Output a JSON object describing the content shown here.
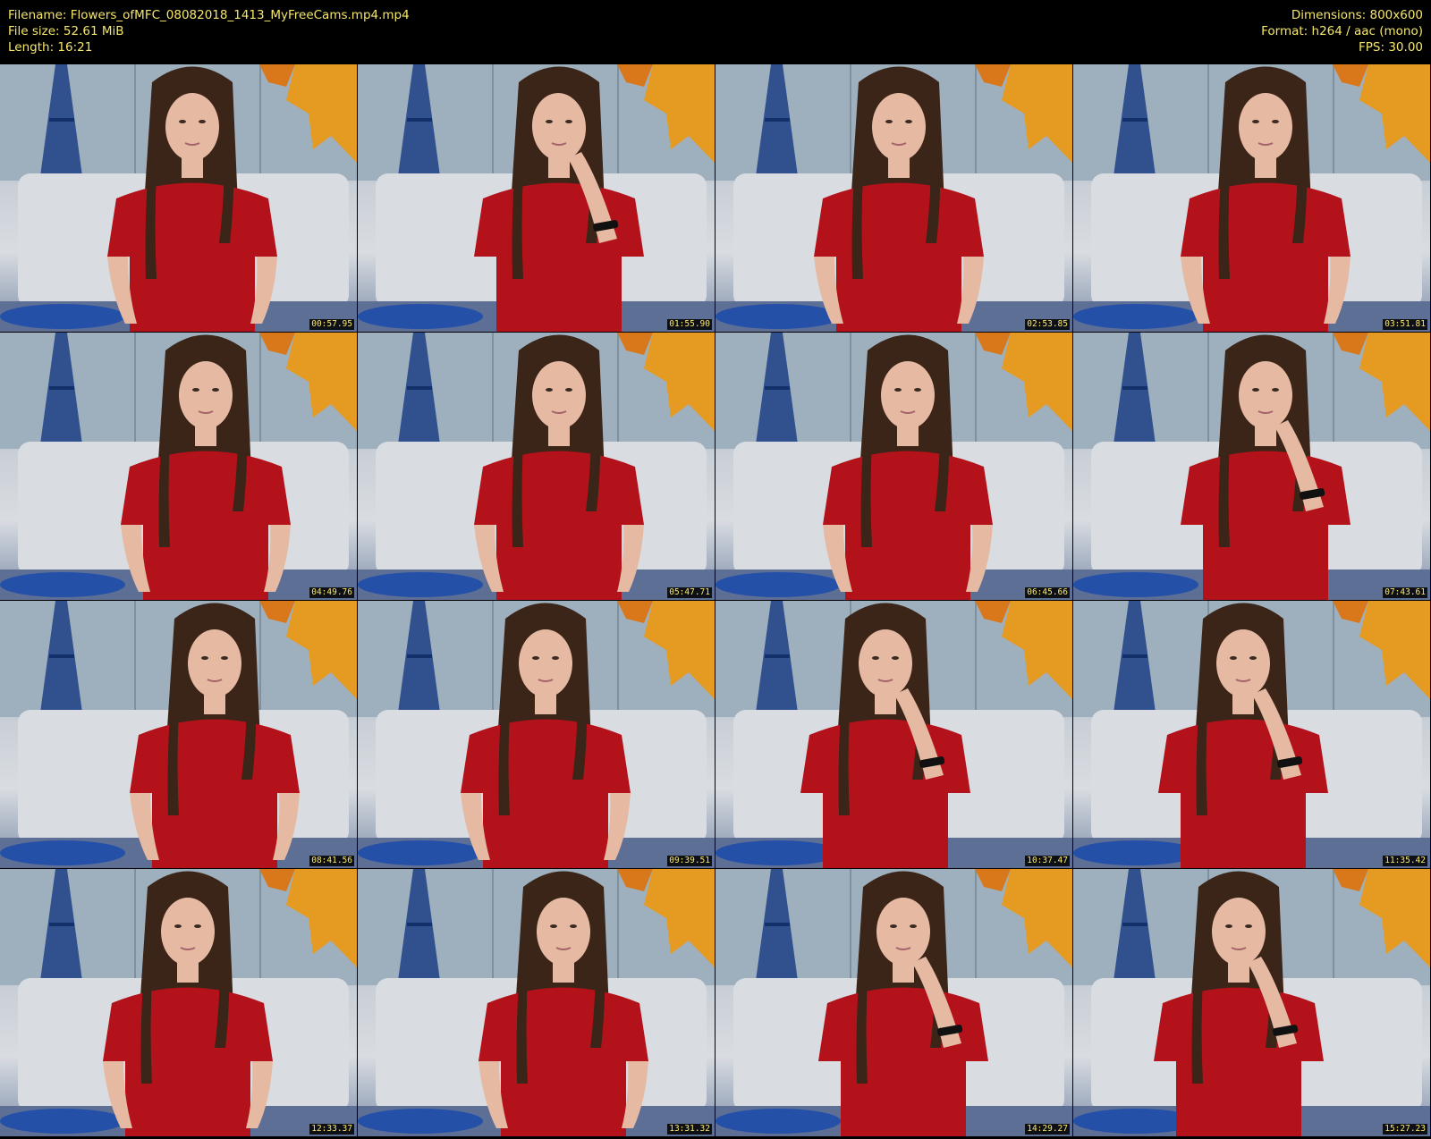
{
  "header": {
    "filename_line": "Filename: Flowers_ofMFC_08082018_1413_MyFreeCams.mp4.mp4",
    "filesize_line": "File size: 52.61 MiB",
    "length_line": "Length: 16:21",
    "dimensions_line": "Dimensions: 800x600",
    "format_line": "Format: h264 / aac (mono)",
    "fps_line": "FPS: 30.00"
  },
  "colors": {
    "header_text": "#f5e76a",
    "background": "#000000",
    "shirt": "#b4121a",
    "hair": "#3b2418",
    "skin": "#e6b9a3",
    "wall": "#9eb0be",
    "headboard": "#d9dde2",
    "tower": "#1d3f86",
    "leaves": "#e59a21"
  },
  "thumbnails": [
    {
      "timestamp": "00:57.95"
    },
    {
      "timestamp": "01:55.90"
    },
    {
      "timestamp": "02:53.85"
    },
    {
      "timestamp": "03:51.81"
    },
    {
      "timestamp": "04:49.76"
    },
    {
      "timestamp": "05:47.71"
    },
    {
      "timestamp": "06:45.66"
    },
    {
      "timestamp": "07:43.61"
    },
    {
      "timestamp": "08:41.56"
    },
    {
      "timestamp": "09:39.51"
    },
    {
      "timestamp": "10:37.47"
    },
    {
      "timestamp": "11:35.42"
    },
    {
      "timestamp": "12:33.37"
    },
    {
      "timestamp": "13:31.32"
    },
    {
      "timestamp": "14:29.27"
    },
    {
      "timestamp": "15:27.23"
    }
  ]
}
